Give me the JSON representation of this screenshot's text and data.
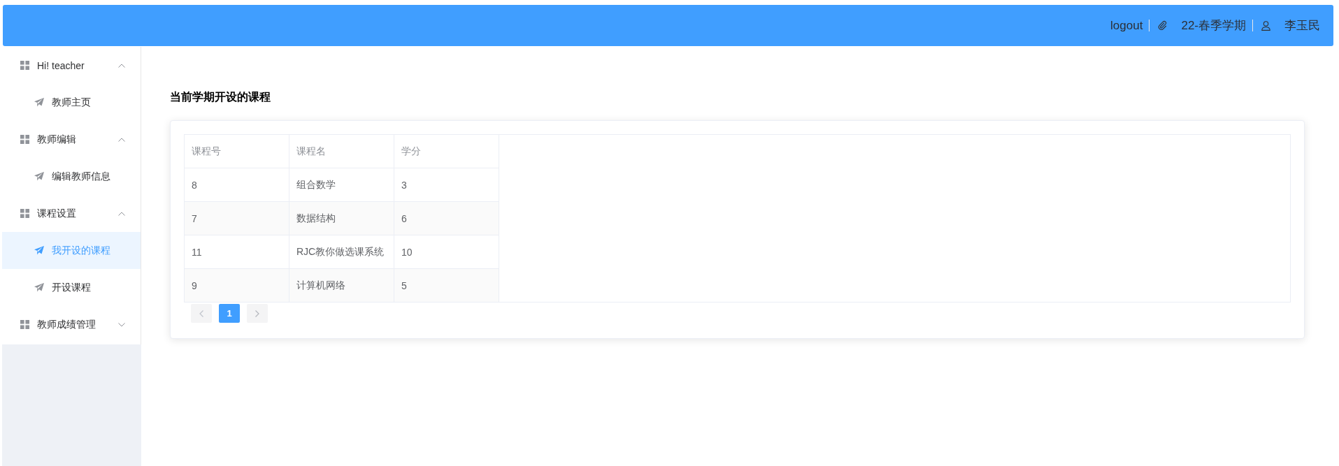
{
  "header": {
    "logout": "logout",
    "term": "22-春季学期",
    "user": "李玉民"
  },
  "sidebar": {
    "groups": [
      {
        "title": "Hi! teacher",
        "expanded": true,
        "children": [
          {
            "label": "教师主页",
            "selected": false
          }
        ]
      },
      {
        "title": "教师编辑",
        "expanded": true,
        "children": [
          {
            "label": "编辑教师信息",
            "selected": false
          }
        ]
      },
      {
        "title": "课程设置",
        "expanded": true,
        "children": [
          {
            "label": "我开设的课程",
            "selected": true
          },
          {
            "label": "开设课程",
            "selected": false
          }
        ]
      },
      {
        "title": "教师成绩管理",
        "expanded": false
      }
    ]
  },
  "main": {
    "title": "当前学期开设的课程",
    "table": {
      "columns": [
        "课程号",
        "课程名",
        "学分"
      ],
      "rows": [
        [
          "8",
          "组合数学",
          "3"
        ],
        [
          "7",
          "数据结构",
          "6"
        ],
        [
          "11",
          "RJC教你做选课系统",
          "10"
        ],
        [
          "9",
          "计算机网络",
          "5"
        ]
      ]
    },
    "pagination": {
      "prev": {
        "disabled": true
      },
      "pages": [
        {
          "label": "1",
          "selected": true
        }
      ],
      "next": {
        "disabled": true
      }
    }
  }
}
